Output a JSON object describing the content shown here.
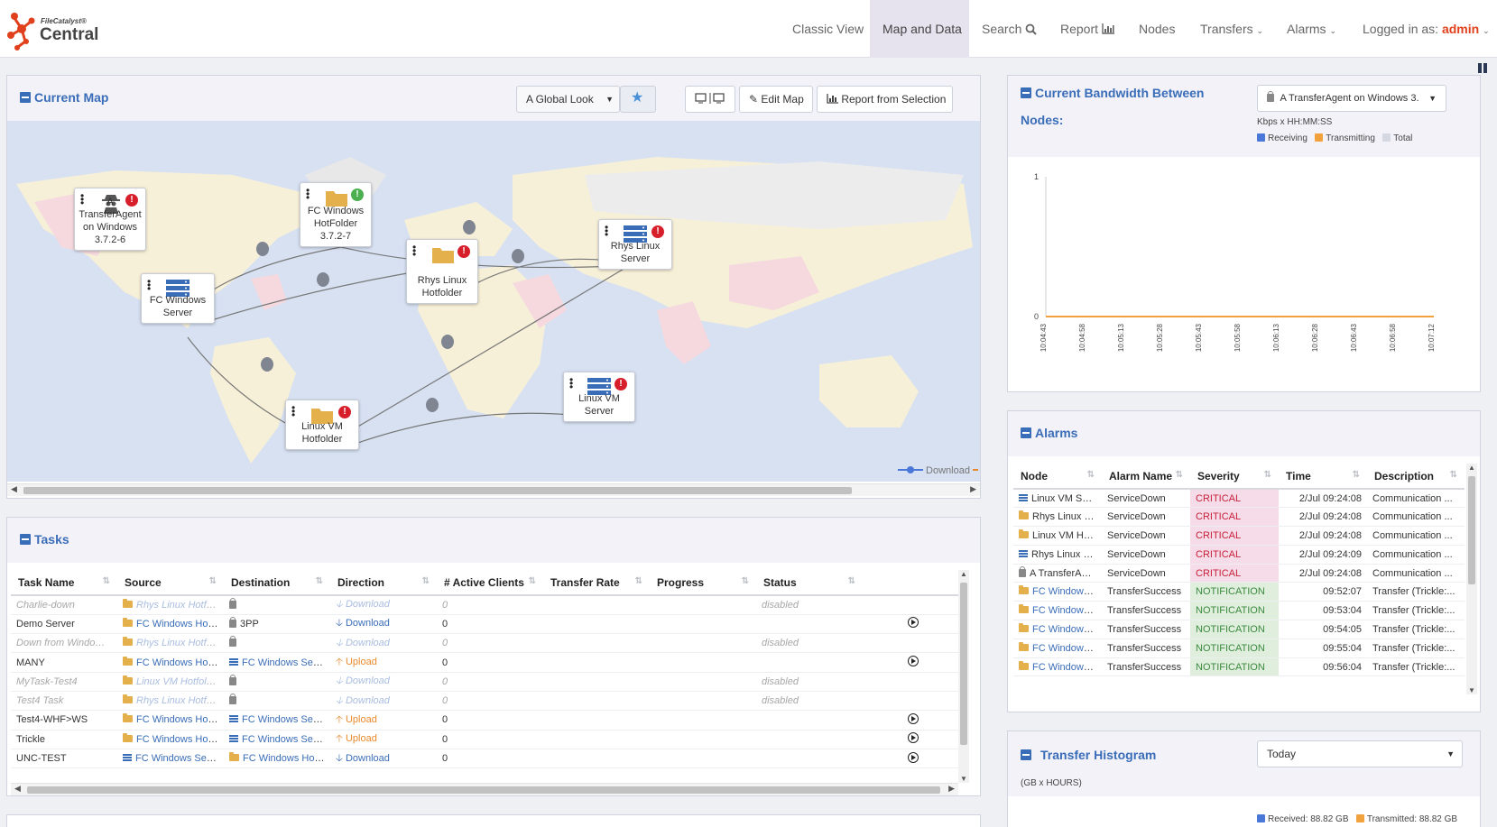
{
  "nav": {
    "brand_small": "FileCatalyst®",
    "brand_big": "Central",
    "items": [
      "Classic View",
      "Map and Data",
      "Search",
      "Report",
      "Nodes",
      "Transfers",
      "Alarms"
    ],
    "logged_in_label": "Logged in as:",
    "user": "admin"
  },
  "map_panel": {
    "title": "Current Map",
    "map_select": "A Global Look",
    "edit_map": "Edit Map",
    "report_btn": "Report from Selection",
    "legend_download": "Download",
    "nodes": [
      {
        "name": "A TransferAgent on Windows 3.7.2-6",
        "icon": "spy-agent-icon",
        "status": "alert"
      },
      {
        "name": "FC Windows HotFolder 3.7.2-7",
        "icon": "folder-icon",
        "status": "ok"
      },
      {
        "name": "Rhys Linux Hotfolder",
        "icon": "folder-icon",
        "status": "alert"
      },
      {
        "name": "Rhys Linux Server",
        "icon": "server-icon",
        "status": "alert"
      },
      {
        "name": "FC Windows Server",
        "icon": "server-icon",
        "status": "none"
      },
      {
        "name": "Linux VM Server",
        "icon": "server-icon",
        "status": "alert"
      },
      {
        "name": "Linux VM Hotfolder",
        "icon": "folder-icon",
        "status": "alert"
      }
    ]
  },
  "tasks": {
    "title": "Tasks",
    "headers": [
      "Task Name",
      "Source",
      "Destination",
      "Direction",
      "# Active Clients",
      "Transfer Rate",
      "Progress",
      "Status"
    ],
    "rows": [
      {
        "name": "Charlie-down",
        "source": "Rhys Linux Hotfolder",
        "src_icon": "folder",
        "dest": "",
        "dest_icon": "lock",
        "dir": "Download",
        "clients": "0",
        "status": "disabled",
        "disabled": true
      },
      {
        "name": "Demo Server",
        "source": "FC Windows HotFol...",
        "src_icon": "folder",
        "dest": "3PP",
        "dest_icon": "lock",
        "dir": "Download",
        "clients": "0",
        "status": "",
        "disabled": false
      },
      {
        "name": "Down from Windows Se...",
        "source": "Rhys Linux Hotfolder",
        "src_icon": "folder",
        "dest": "",
        "dest_icon": "lock",
        "dir": "Download",
        "clients": "0",
        "status": "disabled",
        "disabled": true
      },
      {
        "name": "MANY",
        "source": "FC Windows HotFol...",
        "src_icon": "folder",
        "dest": "FC Windows Server",
        "dest_icon": "srv",
        "dir": "Upload",
        "clients": "0",
        "status": "",
        "disabled": false
      },
      {
        "name": "MyTask-Test4",
        "source": "Linux VM Hotfolder",
        "src_icon": "folder",
        "dest": "",
        "dest_icon": "lock",
        "dir": "Download",
        "clients": "0",
        "status": "disabled",
        "disabled": true
      },
      {
        "name": "Test4 Task",
        "source": "Rhys Linux Hotfolder",
        "src_icon": "folder",
        "dest": "",
        "dest_icon": "lock",
        "dir": "Download",
        "clients": "0",
        "status": "disabled",
        "disabled": true
      },
      {
        "name": "Test4-WHF>WS",
        "source": "FC Windows HotFol...",
        "src_icon": "folder",
        "dest": "FC Windows Server",
        "dest_icon": "srv",
        "dir": "Upload",
        "clients": "0",
        "status": "",
        "disabled": false
      },
      {
        "name": "Trickle",
        "source": "FC Windows HotFol...",
        "src_icon": "folder",
        "dest": "FC Windows Server",
        "dest_icon": "srv",
        "dir": "Upload",
        "clients": "0",
        "status": "",
        "disabled": false
      },
      {
        "name": "UNC-TEST",
        "source": "FC Windows Server",
        "src_icon": "srv",
        "dest": "FC Windows HotFol...",
        "dest_icon": "folder",
        "dir": "Download",
        "clients": "0",
        "status": "",
        "disabled": false
      }
    ]
  },
  "bandwidth": {
    "title_line1": "Current Bandwidth Between",
    "title_line2": "Nodes:",
    "node_select": "A TransferAgent on Windows 3.",
    "units": "Kbps x HH:MM:SS",
    "legend": [
      "Receiving",
      "Transmitting",
      "Total"
    ],
    "colors": {
      "receiving": "#4a78d8",
      "transmitting": "#f2a23c",
      "total": "#d5d8e0"
    }
  },
  "chart_data": {
    "type": "line",
    "title": "",
    "xlabel": "",
    "ylabel": "Kbps x HH:MM:SS",
    "ylim": [
      0,
      1
    ],
    "x": [
      "10:04:43",
      "10:04:58",
      "10:05:13",
      "10:05:28",
      "10:05:43",
      "10:05:58",
      "10:06:13",
      "10:06:28",
      "10:06:43",
      "10:06:58",
      "10:07:12"
    ],
    "series": [
      {
        "name": "Receiving",
        "values": [
          0,
          0,
          0,
          0,
          0,
          0,
          0,
          0,
          0,
          0,
          0
        ]
      },
      {
        "name": "Transmitting",
        "values": [
          0,
          0,
          0,
          0,
          0,
          0,
          0,
          0,
          0,
          0,
          0
        ]
      },
      {
        "name": "Total",
        "values": [
          0,
          0,
          0,
          0,
          0,
          0,
          0,
          0,
          0,
          0,
          0
        ]
      }
    ],
    "y_ticks": [
      "0",
      "1"
    ]
  },
  "alarms": {
    "title": "Alarms",
    "headers": [
      "Node",
      "Alarm Name",
      "Severity",
      "Time",
      "Description"
    ],
    "rows": [
      {
        "node": "Linux VM Server",
        "icon": "srv",
        "name": "ServiceDown",
        "sev": "CRITICAL",
        "time": "2/Jul 09:24:08",
        "desc": "Communication ..."
      },
      {
        "node": "Rhys Linux Hot...",
        "icon": "folder",
        "name": "ServiceDown",
        "sev": "CRITICAL",
        "time": "2/Jul 09:24:08",
        "desc": "Communication ..."
      },
      {
        "node": "Linux VM Hotfo...",
        "icon": "folder",
        "name": "ServiceDown",
        "sev": "CRITICAL",
        "time": "2/Jul 09:24:08",
        "desc": "Communication ..."
      },
      {
        "node": "Rhys Linux Ser...",
        "icon": "srv",
        "name": "ServiceDown",
        "sev": "CRITICAL",
        "time": "2/Jul 09:24:09",
        "desc": "Communication ..."
      },
      {
        "node": "A TransferAgen...",
        "icon": "lock",
        "name": "ServiceDown",
        "sev": "CRITICAL",
        "time": "2/Jul 09:24:08",
        "desc": "Communication ..."
      },
      {
        "node": "FC Windows Ho...",
        "icon": "folder",
        "name": "TransferSuccess",
        "sev": "NOTIFICATION",
        "time": "09:52:07",
        "desc": "Transfer (Trickle:..."
      },
      {
        "node": "FC Windows Ho...",
        "icon": "folder",
        "name": "TransferSuccess",
        "sev": "NOTIFICATION",
        "time": "09:53:04",
        "desc": "Transfer (Trickle:..."
      },
      {
        "node": "FC Windows Ho...",
        "icon": "folder",
        "name": "TransferSuccess",
        "sev": "NOTIFICATION",
        "time": "09:54:05",
        "desc": "Transfer (Trickle:..."
      },
      {
        "node": "FC Windows Ho...",
        "icon": "folder",
        "name": "TransferSuccess",
        "sev": "NOTIFICATION",
        "time": "09:55:04",
        "desc": "Transfer (Trickle:..."
      },
      {
        "node": "FC Windows Ho...",
        "icon": "folder",
        "name": "TransferSuccess",
        "sev": "NOTIFICATION",
        "time": "09:56:04",
        "desc": "Transfer (Trickle:..."
      }
    ]
  },
  "histogram": {
    "title": "Transfer Histogram",
    "period_select": "Today",
    "units": "(GB x HOURS)",
    "received": "Received: 88.82 GB",
    "transmitted": "Transmitted: 88.82 GB"
  }
}
